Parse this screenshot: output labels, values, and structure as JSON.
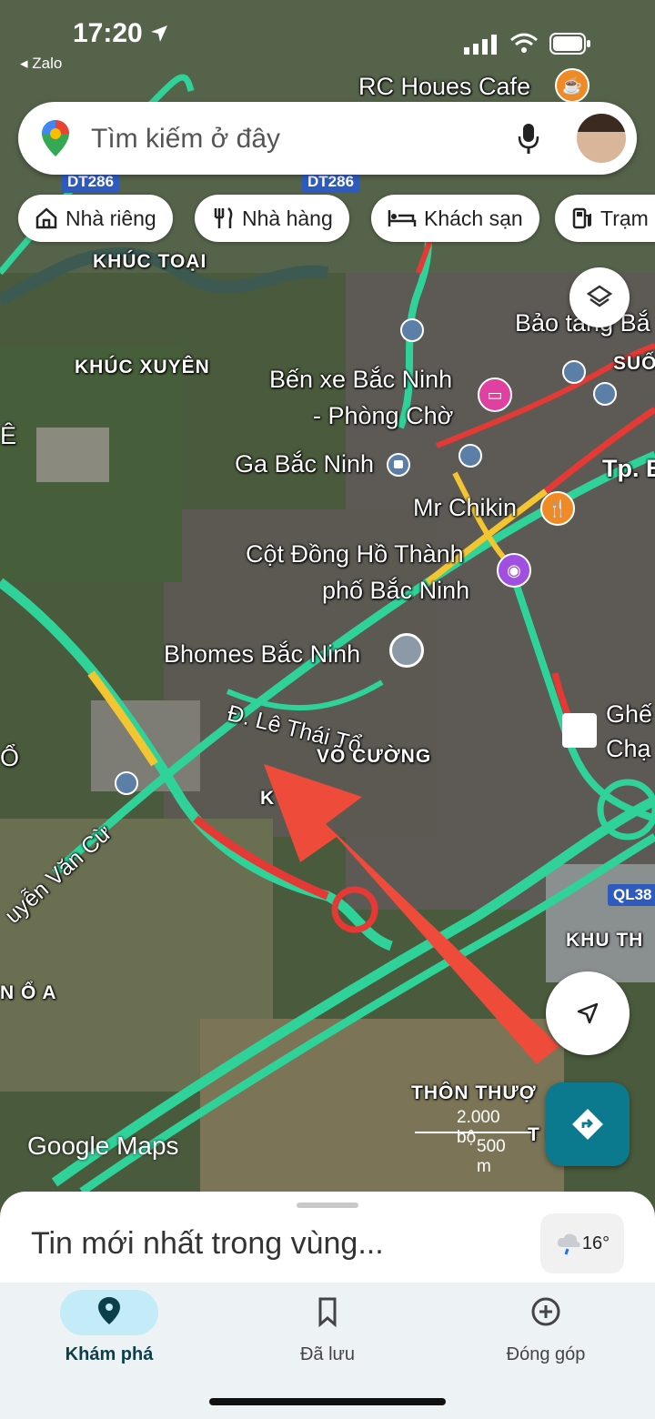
{
  "status_bar": {
    "time": "17:20",
    "back_app": "◂ Zalo"
  },
  "search": {
    "placeholder": "Tìm kiếm ở đây"
  },
  "chips": [
    {
      "label": "Nhà riêng",
      "icon": "home-icon"
    },
    {
      "label": "Nhà hàng",
      "icon": "restaurant-icon"
    },
    {
      "label": "Khách sạn",
      "icon": "hotel-icon"
    },
    {
      "label": "Trạm",
      "icon": "gas-station-icon"
    }
  ],
  "map": {
    "road_shields": [
      "DT286",
      "DT286",
      "QL38"
    ],
    "places": {
      "rc_cafe": "RC Houes Cafe",
      "khuc_toai": "KHÚC TOẠI",
      "khuc_xuyen": "KHÚC XUYÊN",
      "bao_tang": "Bảo tàng Bắ",
      "suo": "SUỐ",
      "ben_xe_1": "Bến xe Bắc Ninh",
      "ben_xe_2": "- Phòng Chờ",
      "ga": "Ga Bắc Ninh",
      "tp": "Tp. B",
      "mr_chikin": "Mr Chikin",
      "cot_dong_ho_1": "Cột Đồng Hồ Thành",
      "cot_dong_ho_2": "phố Bắc Ninh",
      "bhomes": "Bhomes Bắc Ninh",
      "le_thai_to": "Đ. Lê Thái Tổ",
      "vo_cuong": "VÕ CƯỜNG",
      "ghe_1": "Ghế",
      "ghe_2": "Chạ",
      "nguyen_van_cu": "uyễn Văn Cừ",
      "khu_th": "KHU TH",
      "n_o_a": "N Ổ A",
      "thon_thuong": "THÔN THƯỢ",
      "th_hu": "T   HU",
      "e_left": "Ê",
      "o_left": "Ổ",
      "ke": "K   Ế"
    },
    "scale": {
      "imperial": "2.000 bộ",
      "metric": "500 m"
    },
    "logo": "Google Maps"
  },
  "bottom_sheet": {
    "title": "Tin mới nhất trong vùng...",
    "weather": "16°"
  },
  "bottom_nav": [
    {
      "label": "Khám phá",
      "icon": "explore-pin-icon",
      "active": true
    },
    {
      "label": "Đã lưu",
      "icon": "bookmark-icon",
      "active": false
    },
    {
      "label": "Đóng góp",
      "icon": "add-circle-icon",
      "active": false
    }
  ],
  "colors": {
    "traffic_green": "#2fd39a",
    "traffic_red": "#e53935",
    "traffic_yellow": "#f2c531",
    "directions": "#0b7a8f",
    "nav_active": "#c3ecf8"
  }
}
